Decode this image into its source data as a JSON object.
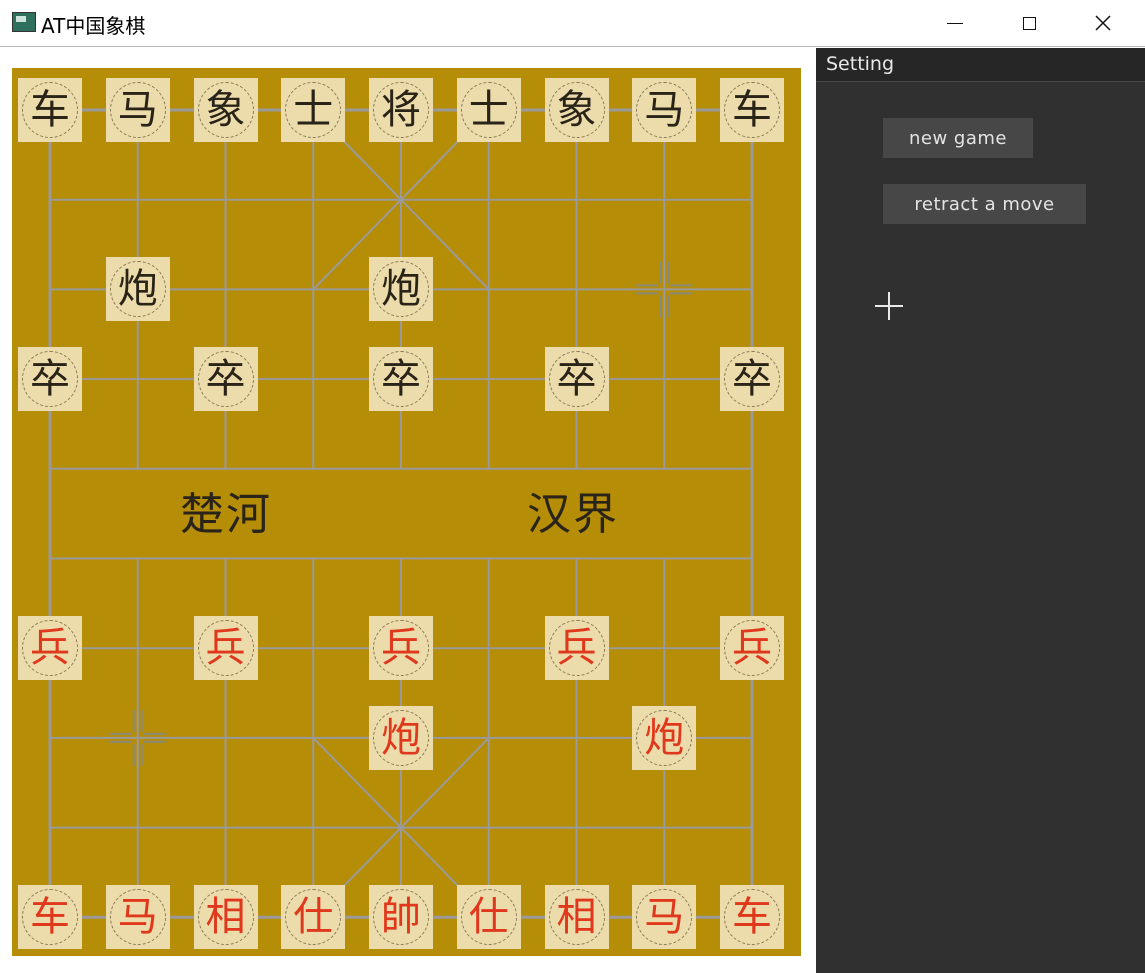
{
  "window": {
    "title": "AT中国象棋",
    "minimize_icon": "minimize-icon",
    "maximize_icon": "maximize-icon",
    "close_icon": "close-icon"
  },
  "board": {
    "river_left": "楚河",
    "river_right": "汉界",
    "colors": {
      "board": "#b58d06",
      "piece_bg": "#ecdcab",
      "black": "#2a2418",
      "red": "#e0381c",
      "line": "#9a9a9a"
    },
    "pieces": [
      {
        "side": "black",
        "char": "车",
        "col": 0,
        "row": 0
      },
      {
        "side": "black",
        "char": "马",
        "col": 1,
        "row": 0
      },
      {
        "side": "black",
        "char": "象",
        "col": 2,
        "row": 0
      },
      {
        "side": "black",
        "char": "士",
        "col": 3,
        "row": 0
      },
      {
        "side": "black",
        "char": "将",
        "col": 4,
        "row": 0
      },
      {
        "side": "black",
        "char": "士",
        "col": 5,
        "row": 0
      },
      {
        "side": "black",
        "char": "象",
        "col": 6,
        "row": 0
      },
      {
        "side": "black",
        "char": "马",
        "col": 7,
        "row": 0
      },
      {
        "side": "black",
        "char": "车",
        "col": 8,
        "row": 0
      },
      {
        "side": "black",
        "char": "炮",
        "col": 1,
        "row": 2
      },
      {
        "side": "black",
        "char": "炮",
        "col": 4,
        "row": 2
      },
      {
        "side": "black",
        "char": "卒",
        "col": 0,
        "row": 3
      },
      {
        "side": "black",
        "char": "卒",
        "col": 2,
        "row": 3
      },
      {
        "side": "black",
        "char": "卒",
        "col": 4,
        "row": 3
      },
      {
        "side": "black",
        "char": "卒",
        "col": 6,
        "row": 3
      },
      {
        "side": "black",
        "char": "卒",
        "col": 8,
        "row": 3
      },
      {
        "side": "red",
        "char": "兵",
        "col": 0,
        "row": 6
      },
      {
        "side": "red",
        "char": "兵",
        "col": 2,
        "row": 6
      },
      {
        "side": "red",
        "char": "兵",
        "col": 4,
        "row": 6
      },
      {
        "side": "red",
        "char": "兵",
        "col": 6,
        "row": 6
      },
      {
        "side": "red",
        "char": "兵",
        "col": 8,
        "row": 6
      },
      {
        "side": "red",
        "char": "炮",
        "col": 4,
        "row": 7
      },
      {
        "side": "red",
        "char": "炮",
        "col": 7,
        "row": 7
      },
      {
        "side": "red",
        "char": "车",
        "col": 0,
        "row": 9
      },
      {
        "side": "red",
        "char": "马",
        "col": 1,
        "row": 9
      },
      {
        "side": "red",
        "char": "相",
        "col": 2,
        "row": 9
      },
      {
        "side": "red",
        "char": "仕",
        "col": 3,
        "row": 9
      },
      {
        "side": "red",
        "char": "帥",
        "col": 4,
        "row": 9
      },
      {
        "side": "red",
        "char": "仕",
        "col": 5,
        "row": 9
      },
      {
        "side": "red",
        "char": "相",
        "col": 6,
        "row": 9
      },
      {
        "side": "red",
        "char": "马",
        "col": 7,
        "row": 9
      },
      {
        "side": "red",
        "char": "车",
        "col": 8,
        "row": 9
      }
    ],
    "empty_markers": [
      {
        "col": 7,
        "row": 2
      },
      {
        "col": 1,
        "row": 7
      }
    ]
  },
  "panel": {
    "title": "Setting",
    "new_game_label": "new game",
    "retract_label": "retract a move"
  }
}
